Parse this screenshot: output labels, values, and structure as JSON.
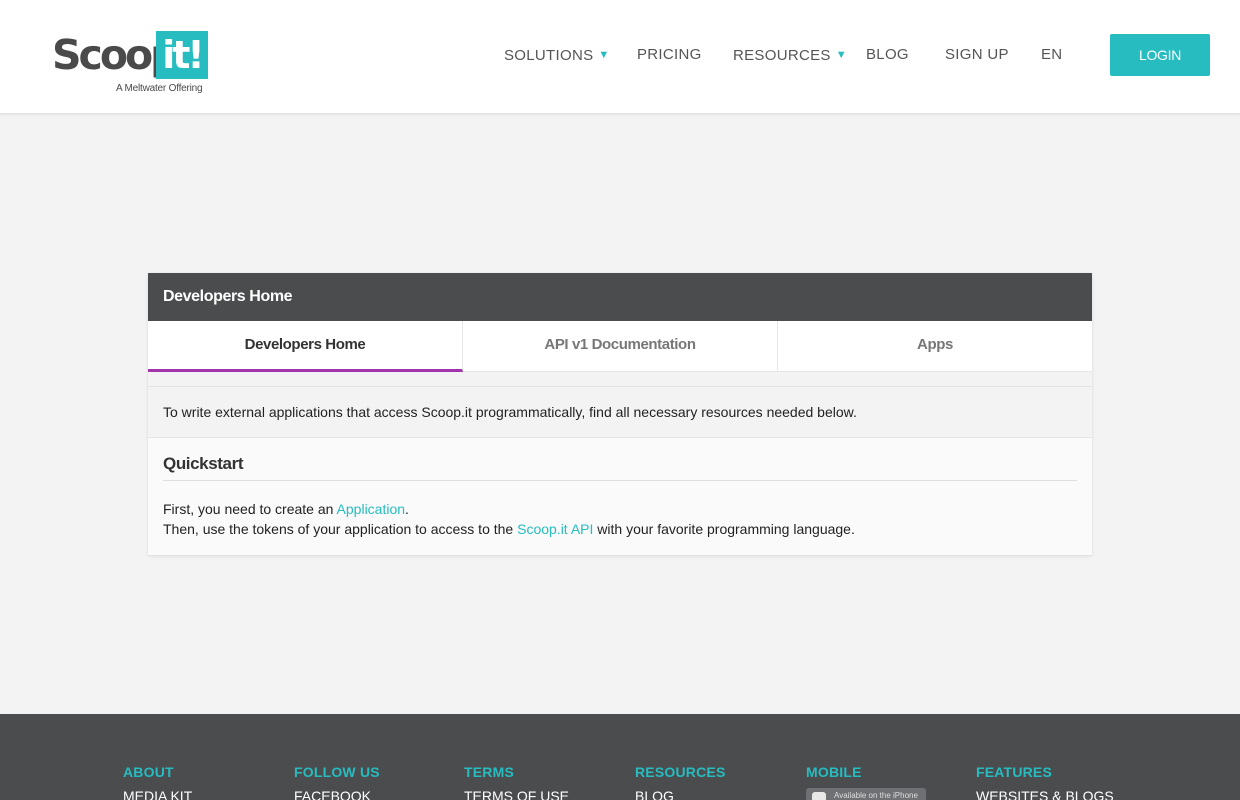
{
  "header": {
    "logo": {
      "word": "Scoop.",
      "box": "it!",
      "sub": "A Meltwater Offering"
    },
    "nav": [
      {
        "label": "SOLUTIONS",
        "caret": "▼"
      },
      {
        "label": "PRICING"
      },
      {
        "label": "RESOURCES",
        "caret": "▼"
      },
      {
        "label": "BLOG"
      },
      {
        "label": "SIGN UP"
      },
      {
        "label": "EN"
      }
    ],
    "login": "LOGIN"
  },
  "card": {
    "title": "Developers Home",
    "tabs": [
      "Developers Home",
      "API v1 Documentation",
      "Apps"
    ],
    "intro": "To write external applications that access Scoop.it programmatically, find all necessary resources needed below.",
    "quickstart": {
      "heading": "Quickstart",
      "line1_before": "First, you need to create an ",
      "line1_link": "Application",
      "line1_after": ".",
      "line2_before": "Then, use the tokens of your application to access to the ",
      "line2_link": "Scoop.it API",
      "line2_after": " with your favorite programming language."
    }
  },
  "footer": {
    "columns": [
      {
        "heading": "ABOUT",
        "first_link": "MEDIA KIT"
      },
      {
        "heading": "FOLLOW US",
        "first_link": "FACEBOOK"
      },
      {
        "heading": "TERMS",
        "first_link": "TERMS OF USE"
      },
      {
        "heading": "RESOURCES",
        "first_link": "BLOG"
      },
      {
        "heading": "MOBILE",
        "badge": "Available on the iPhone"
      },
      {
        "heading": "FEATURES",
        "first_link": "WEBSITES & BLOGS"
      }
    ]
  },
  "colors": {
    "accent": "#26bcc0",
    "tab_active": "#a234ad",
    "dark": "#4b4c4e"
  }
}
